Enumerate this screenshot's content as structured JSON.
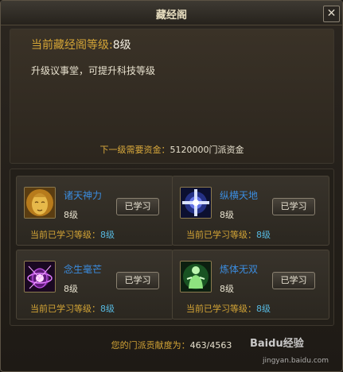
{
  "window": {
    "title": "藏经阁",
    "close_symbol": "✕"
  },
  "info": {
    "level_label": "当前藏经阁等级:",
    "level_value": "8级",
    "upgrade_tip": "升级议事堂，可提升科技等级",
    "next_cost_label": "下一级需要资金：",
    "next_cost_value": "5120000门派资金"
  },
  "skills": [
    {
      "name": "诸天神力",
      "level": "8级",
      "button": "已学习",
      "status_label": "当前已学习等级：",
      "status_value": "8级",
      "icon": "golden-buddha-icon"
    },
    {
      "name": "纵横天地",
      "level": "8级",
      "button": "已学习",
      "status_label": "当前已学习等级：",
      "status_value": "8级",
      "icon": "blue-cross-light-icon"
    },
    {
      "name": "念生毫芒",
      "level": "8级",
      "button": "已学习",
      "status_label": "当前已学习等级：",
      "status_value": "8级",
      "icon": "purple-burst-icon"
    },
    {
      "name": "炼体无双",
      "level": "8级",
      "button": "已学习",
      "status_label": "当前已学习等级：",
      "status_value": "8级",
      "icon": "green-monk-icon"
    }
  ],
  "contribution": {
    "label": "您的门派贡献度为：",
    "value": "463/4563"
  },
  "watermark": {
    "text": "Baidu经验",
    "url": "jingyan.baidu.com"
  }
}
